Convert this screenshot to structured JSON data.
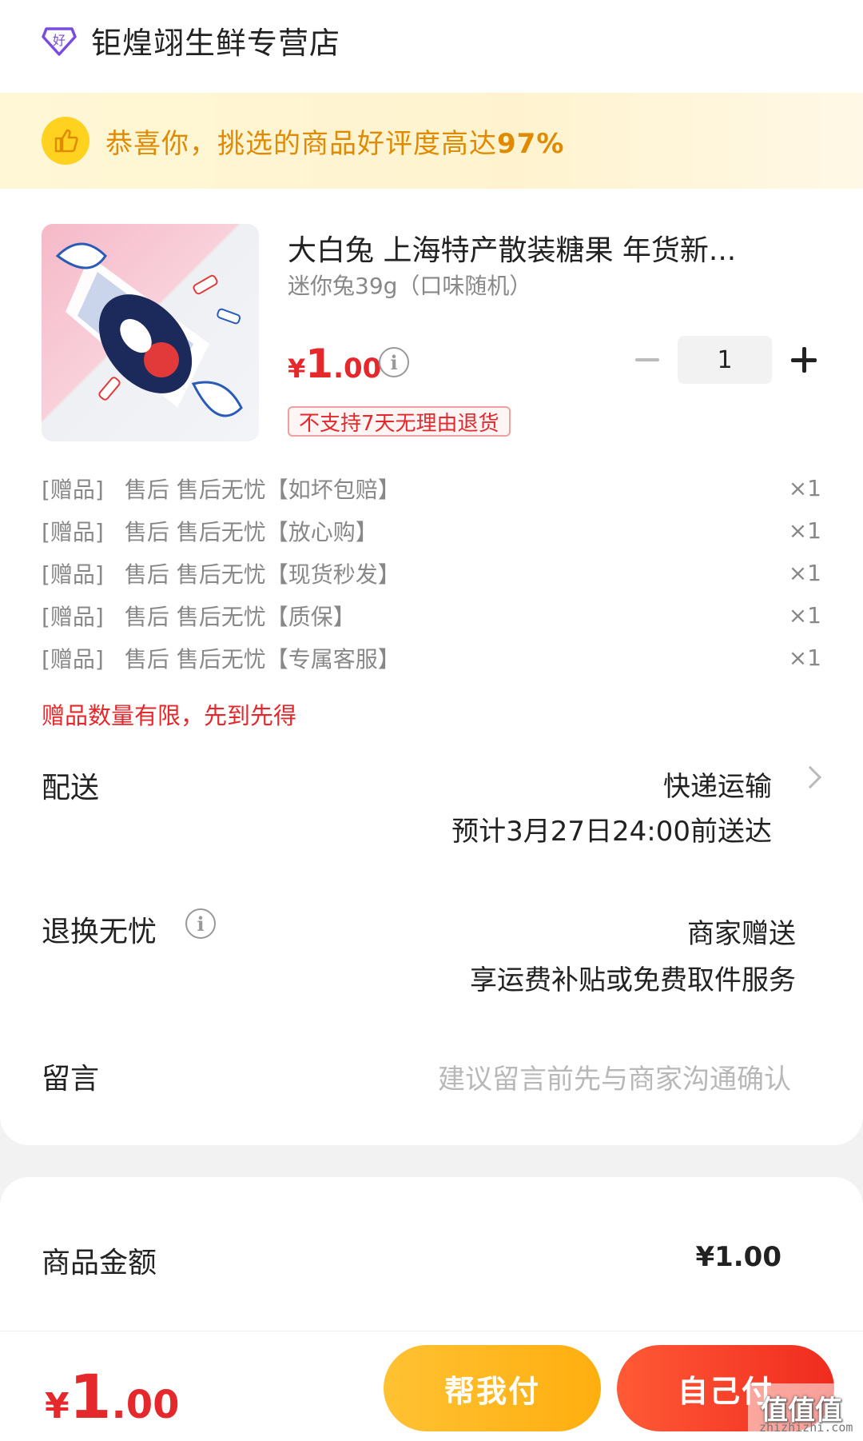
{
  "shop": {
    "name": "钜煌翊生鲜专营店",
    "icon_label": "好"
  },
  "banner": {
    "text_prefix": "恭喜你，挑选的商品好评度高达",
    "text_value": "97%"
  },
  "product": {
    "title": "大白兔 上海特产散装糖果 年货新...",
    "spec": "迷你兔39g（口味随机）",
    "price_yen": "¥",
    "price_int": "1",
    "price_dec": ".00",
    "quantity": "1",
    "return_tag": "不支持7天无理由退货"
  },
  "gifts": [
    {
      "tag": "[赠品]",
      "name": "售后 售后无忧【如坏包赔】",
      "qty": "×1"
    },
    {
      "tag": "[赠品]",
      "name": "售后 售后无忧【放心购】",
      "qty": "×1"
    },
    {
      "tag": "[赠品]",
      "name": "售后 售后无忧【现货秒发】",
      "qty": "×1"
    },
    {
      "tag": "[赠品]",
      "name": "售后 售后无忧【质保】",
      "qty": "×1"
    },
    {
      "tag": "[赠品]",
      "name": "售后 售后无忧【专属客服】",
      "qty": "×1"
    }
  ],
  "gift_note": "赠品数量有限，先到先得",
  "delivery": {
    "label": "配送",
    "method": "快递运输",
    "eta": "预计3月27日24:00前送达"
  },
  "returns": {
    "label": "退换无忧",
    "line1": "商家赠送",
    "line2": "享运费补贴或免费取件服务"
  },
  "message": {
    "label": "留言",
    "placeholder": "建议留言前先与商家沟通确认"
  },
  "summary": {
    "amount_label": "商品金额",
    "amount_value": "¥1.00"
  },
  "footer": {
    "total_yen": "¥",
    "total_int": "1",
    "total_dec": ".00",
    "help_pay": "帮我付",
    "self_pay": "自己付"
  },
  "watermark": {
    "text": "值值值",
    "url": "zhizhizhi.com"
  },
  "colors": {
    "accent": "#e4282c",
    "banner_text": "#e08a00",
    "help_btn": "#ffb51f",
    "self_btn": "#f5381f"
  }
}
